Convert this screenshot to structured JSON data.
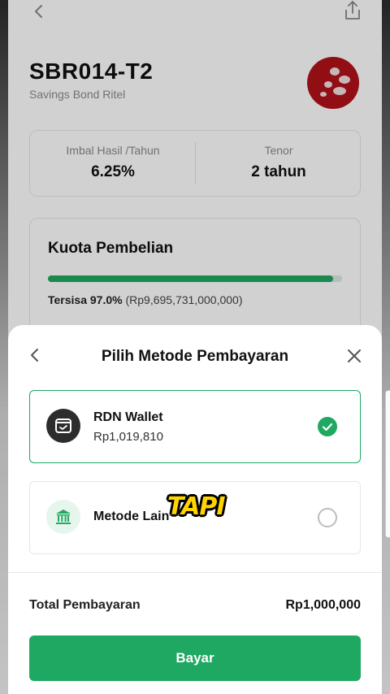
{
  "bond": {
    "code": "SBR014-T2",
    "name": "Savings Bond Ritel",
    "stats": {
      "yield_label": "Imbal Hasil /Tahun",
      "yield_value": "6.25%",
      "tenor_label": "Tenor",
      "tenor_value": "2 tahun"
    },
    "quota": {
      "title": "Kuota Pembelian",
      "remaining_label": "Tersisa 97.0%",
      "remaining_amount": "(Rp9,695,731,000,000)",
      "remaining_fraction": 0.97
    }
  },
  "sheet": {
    "title": "Pilih Metode Pembayaran",
    "options": [
      {
        "name": "RDN Wallet",
        "amount": "Rp1,019,810",
        "icon": "wallet-icon",
        "selected": true
      },
      {
        "name": "Metode Lain",
        "icon": "bank-icon",
        "selected": false
      }
    ],
    "caption": "TAPI",
    "total_label": "Total Pembayaran",
    "total_value": "Rp1,000,000",
    "pay_label": "Bayar"
  },
  "colors": {
    "accent": "#1fa861",
    "logo": "#b3121a"
  }
}
